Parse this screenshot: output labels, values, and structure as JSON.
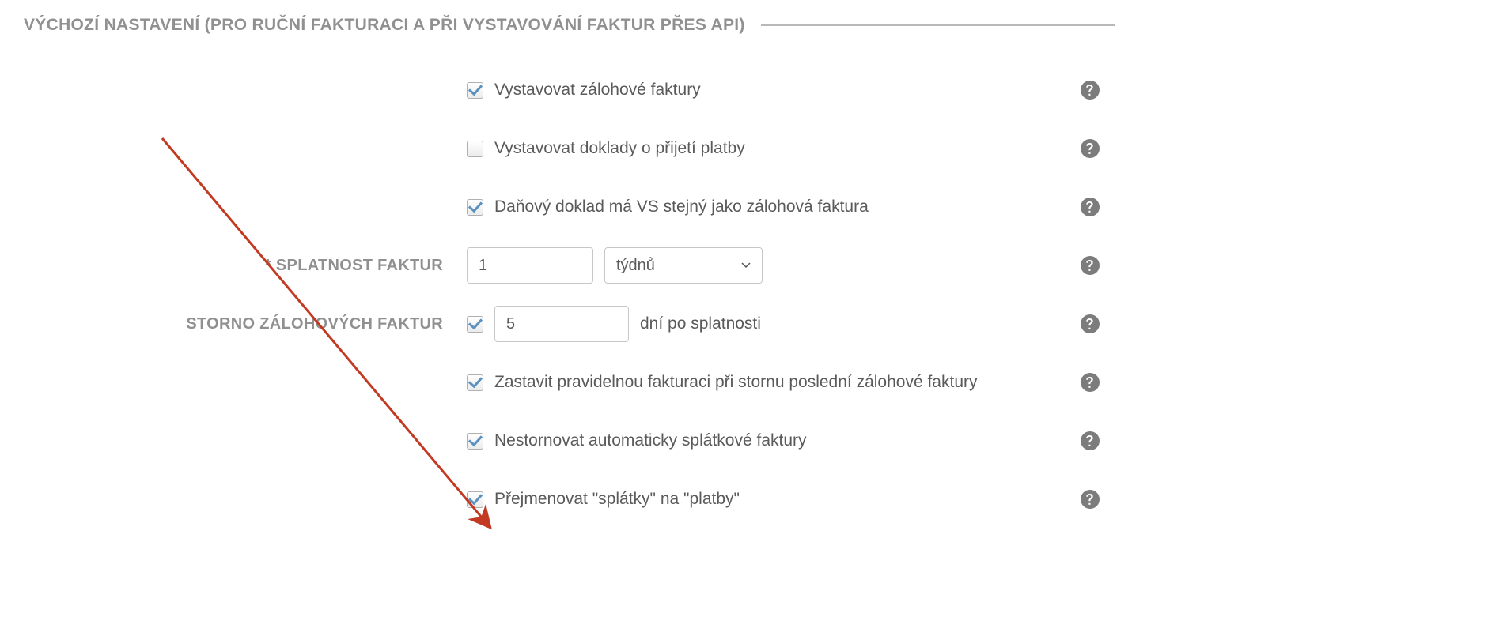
{
  "section_title": "VÝCHOZÍ NASTAVENÍ (PRO RUČNÍ FAKTURACI A PŘI VYSTAVOVÁNÍ FAKTUR PŘES API)",
  "rows": {
    "r1": {
      "label": "Vystavovat zálohové faktury",
      "checked": true
    },
    "r2": {
      "label": "Vystavovat doklady o přijetí platby",
      "checked": false
    },
    "r3": {
      "label": "Daňový doklad má VS stejný jako zálohová faktura",
      "checked": true
    },
    "r4": {
      "row_label": "* SPLATNOST FAKTUR",
      "value": "1",
      "unit_selected": "týdnů"
    },
    "r5": {
      "row_label": "STORNO ZÁLOHOVÝCH FAKTUR",
      "checked": true,
      "value": "5",
      "suffix": "dní po splatnosti"
    },
    "r6": {
      "label": "Zastavit pravidelnou fakturaci při stornu poslední zálohové faktury",
      "checked": true
    },
    "r7": {
      "label": "Nestornovat automaticky splátkové faktury",
      "checked": true
    },
    "r8": {
      "label": "Přejmenovat \"splátky\" na \"platby\"",
      "checked": true
    }
  }
}
